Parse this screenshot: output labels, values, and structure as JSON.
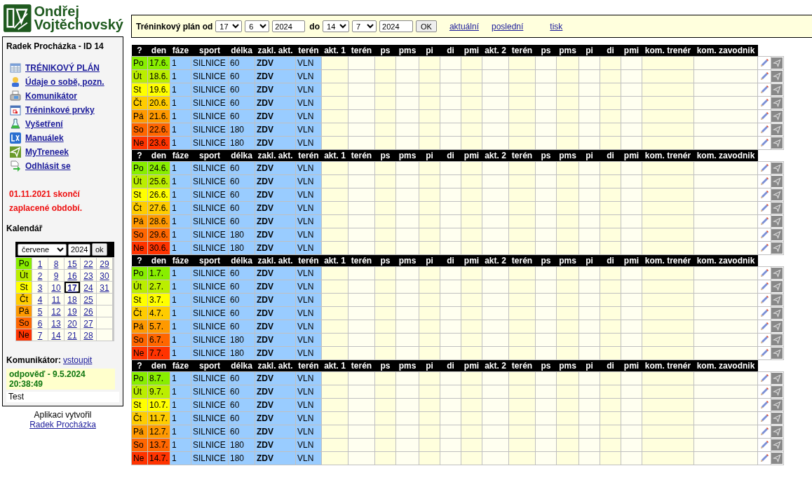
{
  "logo": {
    "line_1": "Ondřej",
    "line_2": "Vojtěchovský"
  },
  "toolbar": {
    "label": "Tréninkový plán od",
    "from_day": "17",
    "from_month": "6",
    "from_year": "2024",
    "to_label": "do",
    "to_day": "14",
    "to_month": "7",
    "to_year": "2024",
    "submit": "OK",
    "links": [
      "aktuální",
      "poslední",
      "tisk"
    ]
  },
  "sidebar": {
    "user": "Radek Procházka - ID 14",
    "menu": [
      {
        "label": "TRÉNIKOVÝ PLÁN",
        "kind": "table"
      },
      {
        "label": "Údaje o sobě, pozn.",
        "kind": "person"
      },
      {
        "label": "Komunikátor",
        "kind": "fax"
      },
      {
        "label": "Tréninkové prvky",
        "kind": "calendar"
      },
      {
        "label": "Vyšetření",
        "kind": "flask"
      },
      {
        "label": "Manuálek",
        "kind": "logo"
      },
      {
        "label": "MyTreneek",
        "kind": "kite"
      },
      {
        "label": "Odhlásit se",
        "kind": "logout"
      }
    ],
    "warning": "01.11.2021 skončí zaplacené období.",
    "calendar_title": "Kalendář",
    "calendar": {
      "month": "červene",
      "year": "2024",
      "submit": "ok",
      "rows": [
        {
          "day": "Po",
          "color": "#88ee00",
          "dates": [
            {
              "text": "1",
              "selected": false
            },
            {
              "text": "8",
              "selected": false
            },
            {
              "text": "15",
              "selected": false
            },
            {
              "text": "22",
              "selected": false
            },
            {
              "text": "29",
              "selected": false
            }
          ]
        },
        {
          "day": "Út",
          "color": "#bbee00",
          "dates": [
            {
              "text": "2",
              "selected": false
            },
            {
              "text": "9",
              "selected": false
            },
            {
              "text": "16",
              "selected": false
            },
            {
              "text": "23",
              "selected": false
            },
            {
              "text": "30",
              "selected": false
            }
          ]
        },
        {
          "day": "St",
          "color": "#ffff00",
          "dates": [
            {
              "text": "3",
              "selected": false
            },
            {
              "text": "10",
              "selected": false
            },
            {
              "text": "17",
              "selected": true
            },
            {
              "text": "24",
              "selected": false
            },
            {
              "text": "31",
              "selected": false
            }
          ]
        },
        {
          "day": "Čt",
          "color": "#ffcc00",
          "dates": [
            {
              "text": "4",
              "selected": false
            },
            {
              "text": "11",
              "selected": false
            },
            {
              "text": "18",
              "selected": false
            },
            {
              "text": "25",
              "selected": false
            }
          ]
        },
        {
          "day": "Pá",
          "color": "#ff9900",
          "dates": [
            {
              "text": "5",
              "selected": false
            },
            {
              "text": "12",
              "selected": false
            },
            {
              "text": "19",
              "selected": false
            },
            {
              "text": "26",
              "selected": false
            }
          ]
        },
        {
          "day": "So",
          "color": "#ff6600",
          "dates": [
            {
              "text": "6",
              "selected": false
            },
            {
              "text": "13",
              "selected": false
            },
            {
              "text": "20",
              "selected": false
            },
            {
              "text": "27",
              "selected": false
            }
          ]
        },
        {
          "day": "Ne",
          "color": "#ff3300",
          "dates": [
            {
              "text": "7",
              "selected": false
            },
            {
              "text": "14",
              "selected": false
            },
            {
              "text": "21",
              "selected": false
            },
            {
              "text": "28",
              "selected": false
            }
          ]
        }
      ]
    },
    "communicator_label": "Komunikátor:",
    "communicator_link": "vstoupit",
    "last_reply": "odpověď - 9.5.2024 20:38:49",
    "message": "Test"
  },
  "footer": {
    "text": "Aplikaci vytvořil",
    "link": "Radek Procházka"
  },
  "weeks": [
    {
      "columns": [
        "?",
        "den",
        "fáze",
        "sport",
        "délka",
        "zakl. akt.",
        "terén",
        "akt. 1",
        "terén",
        "ps",
        "pms",
        "pi",
        "di",
        "pmi",
        "akt. 2",
        "terén",
        "ps",
        "pms",
        "pi",
        "di",
        "pmi",
        "kom. trenér",
        "kom. zavodnik"
      ],
      "rows": [
        {
          "day": "Po",
          "date": "17.6.",
          "phase": "1",
          "sport": "SILNICE",
          "length": "60",
          "base": "ZDV",
          "terrain": "VLN",
          "color": "#88ee00"
        },
        {
          "day": "Út",
          "date": "18.6.",
          "phase": "1",
          "sport": "SILNICE",
          "length": "60",
          "base": "ZDV",
          "terrain": "VLN",
          "color": "#bbee00"
        },
        {
          "day": "St",
          "date": "19.6.",
          "phase": "1",
          "sport": "SILNICE",
          "length": "60",
          "base": "ZDV",
          "terrain": "VLN",
          "color": "#ffff00"
        },
        {
          "day": "Čt",
          "date": "20.6.",
          "phase": "1",
          "sport": "SILNICE",
          "length": "60",
          "base": "ZDV",
          "terrain": "VLN",
          "color": "#ffcc00"
        },
        {
          "day": "Pá",
          "date": "21.6.",
          "phase": "1",
          "sport": "SILNICE",
          "length": "60",
          "base": "ZDV",
          "terrain": "VLN",
          "color": "#ff9900"
        },
        {
          "day": "So",
          "date": "22.6.",
          "phase": "1",
          "sport": "SILNICE",
          "length": "180",
          "base": "ZDV",
          "terrain": "VLN",
          "color": "#ff6600"
        },
        {
          "day": "Ne",
          "date": "23.6.",
          "phase": "1",
          "sport": "SILNICE",
          "length": "180",
          "base": "ZDV",
          "terrain": "VLN",
          "color": "#ff3300"
        }
      ]
    },
    {
      "columns": [
        "?",
        "den",
        "fáze",
        "sport",
        "délka",
        "zakl. akt.",
        "terén",
        "akt. 1",
        "terén",
        "ps",
        "pms",
        "pi",
        "di",
        "pmi",
        "akt. 2",
        "terén",
        "ps",
        "pms",
        "pi",
        "di",
        "pmi",
        "kom. trenér",
        "kom. zavodnik"
      ],
      "rows": [
        {
          "day": "Po",
          "date": "24.6.",
          "phase": "1",
          "sport": "SILNICE",
          "length": "60",
          "base": "ZDV",
          "terrain": "VLN",
          "color": "#88ee00"
        },
        {
          "day": "Út",
          "date": "25.6.",
          "phase": "1",
          "sport": "SILNICE",
          "length": "60",
          "base": "ZDV",
          "terrain": "VLN",
          "color": "#bbee00"
        },
        {
          "day": "St",
          "date": "26.6.",
          "phase": "1",
          "sport": "SILNICE",
          "length": "60",
          "base": "ZDV",
          "terrain": "VLN",
          "color": "#ffff00"
        },
        {
          "day": "Čt",
          "date": "27.6.",
          "phase": "1",
          "sport": "SILNICE",
          "length": "60",
          "base": "ZDV",
          "terrain": "VLN",
          "color": "#ffcc00"
        },
        {
          "day": "Pá",
          "date": "28.6.",
          "phase": "1",
          "sport": "SILNICE",
          "length": "60",
          "base": "ZDV",
          "terrain": "VLN",
          "color": "#ff9900"
        },
        {
          "day": "So",
          "date": "29.6.",
          "phase": "1",
          "sport": "SILNICE",
          "length": "180",
          "base": "ZDV",
          "terrain": "VLN",
          "color": "#ff6600"
        },
        {
          "day": "Ne",
          "date": "30.6.",
          "phase": "1",
          "sport": "SILNICE",
          "length": "180",
          "base": "ZDV",
          "terrain": "VLN",
          "color": "#ff3300"
        }
      ]
    },
    {
      "columns": [
        "?",
        "den",
        "fáze",
        "sport",
        "délka",
        "zakl. akt.",
        "terén",
        "akt. 1",
        "terén",
        "ps",
        "pms",
        "pi",
        "di",
        "pmi",
        "akt. 2",
        "terén",
        "ps",
        "pms",
        "pi",
        "di",
        "pmi",
        "kom. trenér",
        "kom. zavodnik"
      ],
      "rows": [
        {
          "day": "Po",
          "date": "1.7.",
          "phase": "1",
          "sport": "SILNICE",
          "length": "60",
          "base": "ZDV",
          "terrain": "VLN",
          "color": "#88ee00"
        },
        {
          "day": "Út",
          "date": "2.7.",
          "phase": "1",
          "sport": "SILNICE",
          "length": "60",
          "base": "ZDV",
          "terrain": "VLN",
          "color": "#bbee00"
        },
        {
          "day": "St",
          "date": "3.7.",
          "phase": "1",
          "sport": "SILNICE",
          "length": "60",
          "base": "ZDV",
          "terrain": "VLN",
          "color": "#ffff00"
        },
        {
          "day": "Čt",
          "date": "4.7.",
          "phase": "1",
          "sport": "SILNICE",
          "length": "60",
          "base": "ZDV",
          "terrain": "VLN",
          "color": "#ffcc00"
        },
        {
          "day": "Pá",
          "date": "5.7.",
          "phase": "1",
          "sport": "SILNICE",
          "length": "60",
          "base": "ZDV",
          "terrain": "VLN",
          "color": "#ff9900"
        },
        {
          "day": "So",
          "date": "6.7.",
          "phase": "1",
          "sport": "SILNICE",
          "length": "180",
          "base": "ZDV",
          "terrain": "VLN",
          "color": "#ff6600"
        },
        {
          "day": "Ne",
          "date": "7.7.",
          "phase": "1",
          "sport": "SILNICE",
          "length": "180",
          "base": "ZDV",
          "terrain": "VLN",
          "color": "#ff3300"
        }
      ]
    },
    {
      "columns": [
        "?",
        "den",
        "fáze",
        "sport",
        "délka",
        "zakl. akt.",
        "terén",
        "akt. 1",
        "terén",
        "ps",
        "pms",
        "pi",
        "di",
        "pmi",
        "akt. 2",
        "terén",
        "ps",
        "pms",
        "pi",
        "di",
        "pmi",
        "kom. trenér",
        "kom. zavodnik"
      ],
      "rows": [
        {
          "day": "Po",
          "date": "8.7.",
          "phase": "1",
          "sport": "SILNICE",
          "length": "60",
          "base": "ZDV",
          "terrain": "VLN",
          "color": "#88ee00"
        },
        {
          "day": "Út",
          "date": "9.7.",
          "phase": "1",
          "sport": "SILNICE",
          "length": "60",
          "base": "ZDV",
          "terrain": "VLN",
          "color": "#bbee00"
        },
        {
          "day": "St",
          "date": "10.7.",
          "phase": "1",
          "sport": "SILNICE",
          "length": "60",
          "base": "ZDV",
          "terrain": "VLN",
          "color": "#ffff00"
        },
        {
          "day": "Čt",
          "date": "11.7.",
          "phase": "1",
          "sport": "SILNICE",
          "length": "60",
          "base": "ZDV",
          "terrain": "VLN",
          "color": "#ffcc00"
        },
        {
          "day": "Pá",
          "date": "12.7.",
          "phase": "1",
          "sport": "SILNICE",
          "length": "60",
          "base": "ZDV",
          "terrain": "VLN",
          "color": "#ff9900"
        },
        {
          "day": "So",
          "date": "13.7.",
          "phase": "1",
          "sport": "SILNICE",
          "length": "180",
          "base": "ZDV",
          "terrain": "VLN",
          "color": "#ff6600"
        },
        {
          "day": "Ne",
          "date": "14.7.",
          "phase": "1",
          "sport": "SILNICE",
          "length": "180",
          "base": "ZDV",
          "terrain": "VLN",
          "color": "#ff3300"
        }
      ]
    }
  ]
}
